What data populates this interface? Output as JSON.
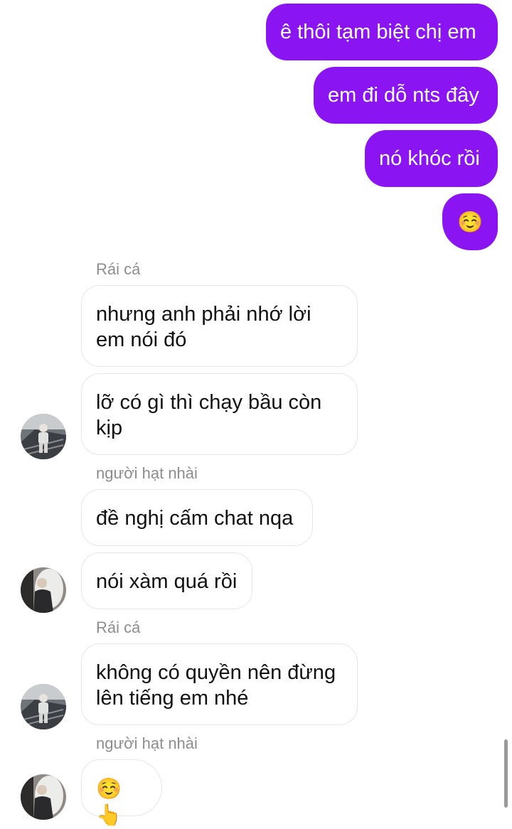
{
  "outgoing": [
    {
      "text": "ê thôi tạm biệt chị em"
    },
    {
      "text": "em đi dỗ nts đây"
    },
    {
      "text": "nó khóc rồi"
    },
    {
      "text": "☺️"
    }
  ],
  "groups": [
    {
      "sender": "Rái cá",
      "messages": [
        {
          "line1": "nhưng anh phải nhớ lời",
          "line2": "em nói đó"
        },
        {
          "line1": "lỡ có gì thì chạy bầu còn",
          "line2": "kịp"
        }
      ]
    },
    {
      "sender": "người hạt nhài",
      "messages": [
        {
          "text": "đề nghị cấm chat nqa"
        },
        {
          "text": "nói xàm quá rồi"
        }
      ]
    },
    {
      "sender": "Rái cá",
      "messages": [
        {
          "line1": "không có quyền nên đừng",
          "line2": "lên tiếng em nhé"
        }
      ]
    },
    {
      "sender": "người hạt nhài",
      "messages": [
        {
          "text": "☺️👆"
        }
      ]
    }
  ],
  "colors": {
    "outgoing_bubble": "#8a14f2",
    "incoming_border": "#e6e6e6",
    "sender_text": "#8d8d8d"
  }
}
